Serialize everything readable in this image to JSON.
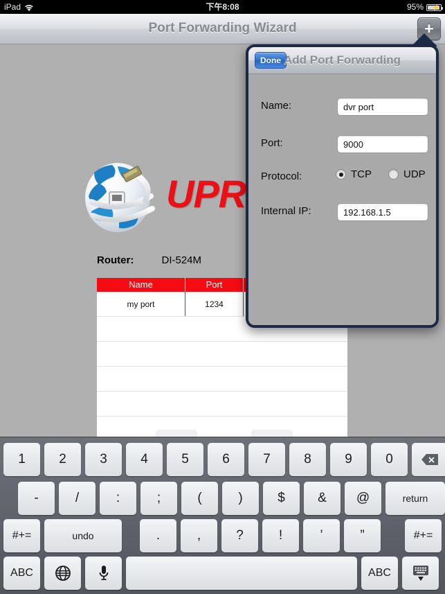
{
  "status_bar": {
    "device": "iPad",
    "wifi_icon": "wifi-icon",
    "time": "下午8:08",
    "battery_percent": "95%",
    "battery_icon": "battery-charging-icon"
  },
  "nav_bar": {
    "title": "Port Forwarding Wizard",
    "add_button_label": "+",
    "add_button_icon": "plus-icon"
  },
  "main": {
    "logo_icon": "globe-ethernet-logo",
    "logo_text": "UPRE",
    "router_label": "Router:",
    "router_value": "DI-524M",
    "table": {
      "columns": [
        "Name",
        "Port",
        ""
      ],
      "rows": [
        [
          "my port",
          "1234",
          ""
        ]
      ],
      "empty_row_count": 5
    }
  },
  "popover": {
    "done_label": "Done",
    "title": "Add Port Forwarding",
    "fields": [
      {
        "label": "Name:",
        "value": "dvr port"
      },
      {
        "label": "Port:",
        "value": "9000"
      },
      {
        "label": "Internal IP:",
        "value": "192.168.1.5"
      }
    ],
    "protocol": {
      "label": "Protocol:",
      "options": [
        {
          "label": "TCP",
          "selected": true
        },
        {
          "label": "UDP",
          "selected": false
        }
      ]
    }
  },
  "keyboard": {
    "row1": [
      "1",
      "2",
      "3",
      "4",
      "5",
      "6",
      "7",
      "8",
      "9",
      "0"
    ],
    "backspace_icon": "backspace-icon",
    "row2": [
      "-",
      "/",
      ":",
      ";",
      "(",
      ")",
      "$",
      "&",
      "@"
    ],
    "return_label": "return",
    "row3_left": "#+=",
    "undo_label": "undo",
    "row3_mid": [
      ".",
      ",",
      "?",
      "!",
      "’",
      "”"
    ],
    "row3_right": "#+=",
    "abc_left": "ABC",
    "globe_icon": "globe-icon",
    "mic_icon": "microphone-icon",
    "space_label": "",
    "abc_right": "ABC",
    "hide_icon": "hide-keyboard-icon"
  },
  "colors": {
    "accent_red": "#f40c12",
    "popover_border": "#1d2a46",
    "done_blue": "#2f6fd0",
    "app_background": "#b0b0b0"
  }
}
